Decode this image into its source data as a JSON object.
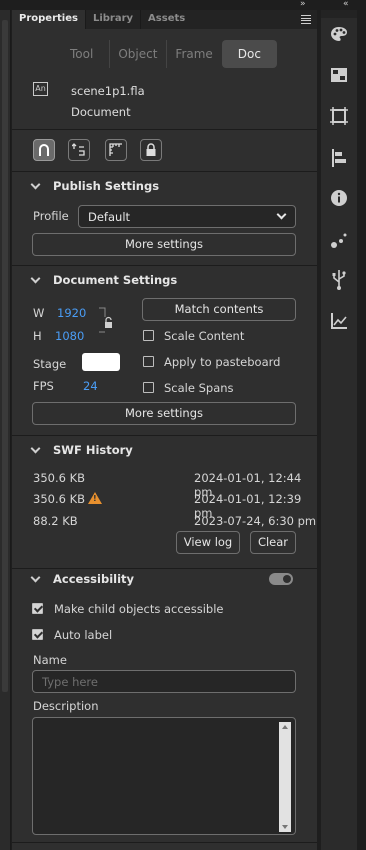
{
  "window": {
    "collapse_left": "»",
    "collapse_right": "«"
  },
  "tabs": [
    {
      "label": "Properties",
      "active": true
    },
    {
      "label": "Library",
      "active": false
    },
    {
      "label": "Assets",
      "active": false
    }
  ],
  "segmented": [
    {
      "label": "Tool",
      "active": false
    },
    {
      "label": "Object",
      "active": false
    },
    {
      "label": "Frame",
      "active": false
    },
    {
      "label": "Doc",
      "active": true
    }
  ],
  "doc_info": {
    "icon_text": "An",
    "filename": "scene1p1.fla",
    "type": "Document"
  },
  "icon_toolbar": [
    "snap-to-objects-icon",
    "edit-guides-icon",
    "rulers-icon",
    "lock-icon"
  ],
  "publish_settings": {
    "title": "Publish Settings",
    "profile_label": "Profile",
    "profile_value": "Default",
    "more_settings": "More settings"
  },
  "document_settings": {
    "title": "Document Settings",
    "w_label": "W",
    "w_value": "1920",
    "h_label": "H",
    "h_value": "1080",
    "match_contents": "Match contents",
    "scale_content": "Scale Content",
    "apply_pasteboard": "Apply to pasteboard",
    "scale_spans": "Scale Spans",
    "stage_label": "Stage",
    "stage_color": "#ffffff",
    "fps_label": "FPS",
    "fps_value": "24",
    "more_settings": "More settings"
  },
  "swf_history": {
    "title": "SWF History",
    "rows": [
      {
        "size": "350.6 KB",
        "date": "2024-01-01, 12:44 pm",
        "warning": false
      },
      {
        "size": "350.6 KB",
        "date": "2024-01-01, 12:39 pm",
        "warning": true
      },
      {
        "size": "88.2 KB",
        "date": "2023-07-24, 6:30 pm",
        "warning": false
      }
    ],
    "view_log": "View log",
    "clear": "Clear"
  },
  "accessibility": {
    "title": "Accessibility",
    "enabled": true,
    "make_child": "Make child objects accessible",
    "make_child_checked": true,
    "auto_label": "Auto label",
    "auto_label_checked": true,
    "name_label": "Name",
    "name_placeholder": "Type here",
    "description_label": "Description"
  },
  "right_toolbar": [
    "color-palette-icon",
    "swatches-icon",
    "align-icon",
    "align-left-icon",
    "info-icon",
    "motion-icon",
    "usb-icon",
    "chart-icon"
  ]
}
